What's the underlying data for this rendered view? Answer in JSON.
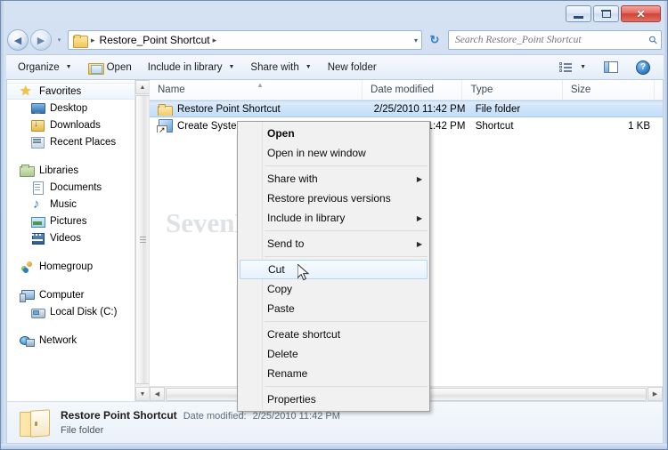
{
  "window": {
    "titlebar_buttons": [
      {
        "name": "minimize",
        "label": "—"
      },
      {
        "name": "maximize",
        "label": "□"
      },
      {
        "name": "close",
        "label": "✕"
      }
    ]
  },
  "address": {
    "back_glyph": "◀",
    "forward_glyph": "▶",
    "recent_glyph": "▾",
    "breadcrumb": "Restore_Point Shortcut",
    "breadcrumb_sep": "▸",
    "dropdown_glyph": "▾",
    "refresh_glyph": "↻"
  },
  "search": {
    "placeholder": "Search Restore_Point Shortcut",
    "value": "",
    "icon": "search-icon"
  },
  "toolbar": {
    "organize": "Organize",
    "open": "Open",
    "include_in_library": "Include in library",
    "share_with": "Share with",
    "new_folder": "New folder",
    "caret": "▼",
    "view_icon": "view-list-icon",
    "preview_pane_icon": "preview-pane-icon",
    "help_icon": "help-icon",
    "help_label": "?"
  },
  "sidebar": {
    "items": [
      {
        "label": "Favorites",
        "icon": "star-icon",
        "level": 0,
        "hovered": true
      },
      {
        "label": "Desktop",
        "icon": "desktop-icon",
        "level": 1,
        "hovered": false
      },
      {
        "label": "Downloads",
        "icon": "downloads-icon",
        "level": 1,
        "hovered": false
      },
      {
        "label": "Recent Places",
        "icon": "recent-places-icon",
        "level": 1,
        "hovered": false
      },
      {
        "label": "Libraries",
        "icon": "library-icon",
        "level": 0,
        "hovered": false,
        "gap_before": true
      },
      {
        "label": "Documents",
        "icon": "document-icon",
        "level": 1,
        "hovered": false
      },
      {
        "label": "Music",
        "icon": "music-icon",
        "level": 1,
        "hovered": false
      },
      {
        "label": "Pictures",
        "icon": "pictures-icon",
        "level": 1,
        "hovered": false
      },
      {
        "label": "Videos",
        "icon": "videos-icon",
        "level": 1,
        "hovered": false
      },
      {
        "label": "Homegroup",
        "icon": "homegroup-icon",
        "level": 0,
        "hovered": false,
        "gap_before": true
      },
      {
        "label": "Computer",
        "icon": "computer-icon",
        "level": 0,
        "hovered": false,
        "gap_before": true
      },
      {
        "label": "Local Disk (C:)",
        "icon": "disk-icon",
        "level": 1,
        "hovered": false
      },
      {
        "label": "Network",
        "icon": "network-icon",
        "level": 0,
        "hovered": false,
        "gap_before": true
      }
    ],
    "scroll_up_glyph": "▲",
    "scroll_down_glyph": "▼"
  },
  "filelist": {
    "columns": [
      {
        "key": "name",
        "label": "Name"
      },
      {
        "key": "date",
        "label": "Date modified"
      },
      {
        "key": "type",
        "label": "Type"
      },
      {
        "key": "size",
        "label": "Size"
      }
    ],
    "sort_indicator": "▲",
    "rows": [
      {
        "name": "Restore Point Shortcut",
        "date": "2/25/2010 11:42 PM",
        "type": "File folder",
        "size": "",
        "icon": "folder-icon",
        "selected": true
      },
      {
        "name": "Create System Restore Point",
        "date": "2/25/2010 11:42 PM",
        "type": "Shortcut",
        "size": "1 KB",
        "icon": "shortcut-icon",
        "selected": false
      }
    ],
    "hscroll_left_glyph": "◀",
    "hscroll_right_glyph": "▶"
  },
  "context_menu": {
    "items": [
      {
        "label": "Open",
        "bold": true,
        "submenu": false,
        "hover": false
      },
      {
        "label": "Open in new window",
        "bold": false,
        "submenu": false,
        "hover": false
      },
      {
        "separator": true
      },
      {
        "label": "Share with",
        "bold": false,
        "submenu": true,
        "hover": false
      },
      {
        "label": "Restore previous versions",
        "bold": false,
        "submenu": false,
        "hover": false
      },
      {
        "label": "Include in library",
        "bold": false,
        "submenu": true,
        "hover": false
      },
      {
        "separator": true
      },
      {
        "label": "Send to",
        "bold": false,
        "submenu": true,
        "hover": false
      },
      {
        "separator": true
      },
      {
        "label": "Cut",
        "bold": false,
        "submenu": false,
        "hover": true
      },
      {
        "label": "Copy",
        "bold": false,
        "submenu": false,
        "hover": false
      },
      {
        "label": "Paste",
        "bold": false,
        "submenu": false,
        "hover": false
      },
      {
        "separator": true
      },
      {
        "label": "Create shortcut",
        "bold": false,
        "submenu": false,
        "hover": false
      },
      {
        "label": "Delete",
        "bold": false,
        "submenu": false,
        "hover": false
      },
      {
        "label": "Rename",
        "bold": false,
        "submenu": false,
        "hover": false
      },
      {
        "separator": true
      },
      {
        "label": "Properties",
        "bold": false,
        "submenu": false,
        "hover": false
      }
    ],
    "submenu_arrow": "▶"
  },
  "details": {
    "name": "Restore Point Shortcut",
    "date_label": "Date modified:",
    "date_value": "2/25/2010 11:42 PM",
    "type": "File folder"
  },
  "watermark": {
    "text": "SevenForums.com"
  },
  "colors": {
    "selection_blue": "#cfe4f9",
    "menu_hover": "#e7f2fc",
    "glass_frame": "#cfdcef",
    "close_red": "#cf4236",
    "folder_yellow": "#f0c55f"
  }
}
